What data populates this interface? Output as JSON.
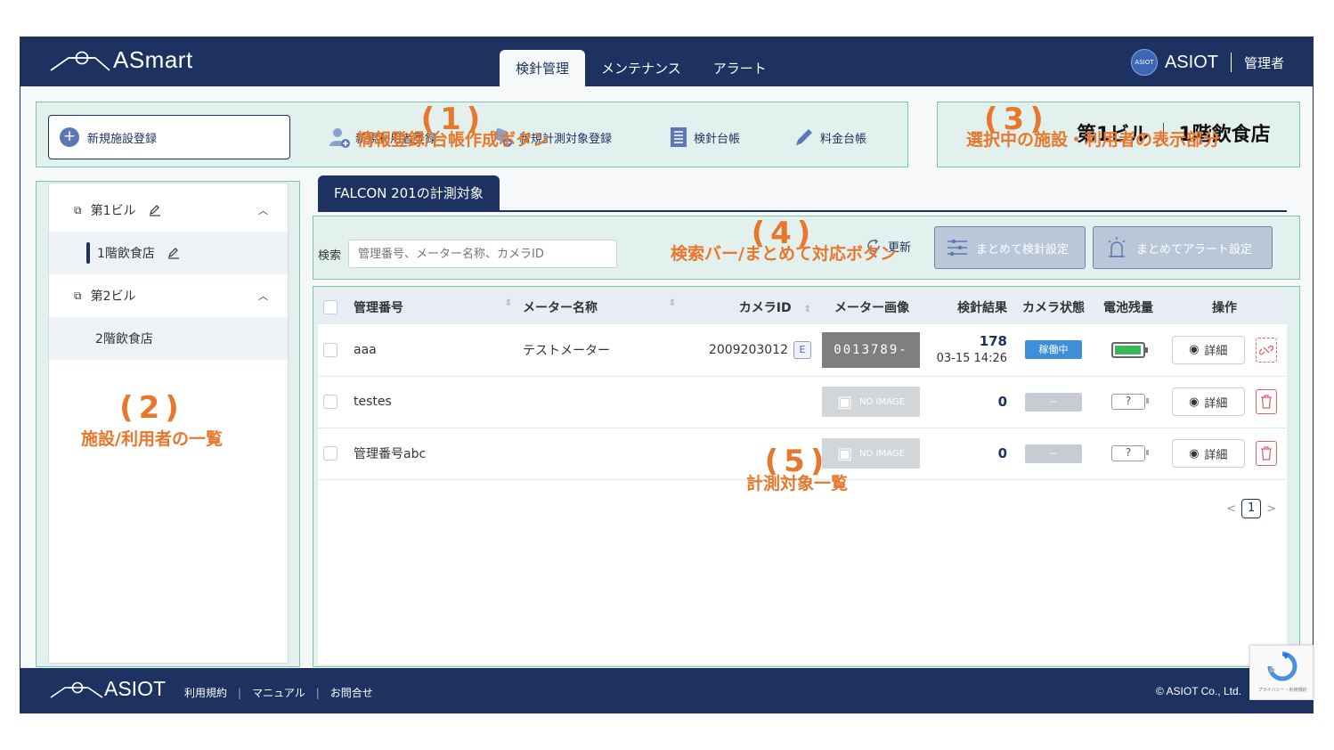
{
  "header": {
    "logo": "ASmart",
    "tabs": [
      "検針管理",
      "メンテナンス",
      "アラート"
    ],
    "user": {
      "avatar_text": "ASIOT",
      "name": "ASIOT",
      "role": "管理者"
    }
  },
  "actions": {
    "new_facility": "新規施設登録",
    "new_user": "新規利用者登録",
    "new_target": "新規計測対象登録",
    "reading_ledger": "検針台帳",
    "fee_ledger": "料金台帳"
  },
  "selected": {
    "facility": "第1ビル",
    "user": "1階飲食店"
  },
  "sidebar": {
    "items": [
      {
        "label": "第1ビル",
        "type": "facility",
        "editable": true,
        "expanded": true
      },
      {
        "label": "1階飲食店",
        "type": "user",
        "editable": true,
        "selected": true
      },
      {
        "label": "第2ビル",
        "type": "facility",
        "editable": false,
        "expanded": true
      },
      {
        "label": "2階飲食店",
        "type": "user",
        "editable": false
      }
    ]
  },
  "main": {
    "tab": "FALCON 201の計測対象",
    "search_label": "検索",
    "search_placeholder": "管理番号、メーター名称、カメラID",
    "refresh": "更新",
    "bulk_reading": "まとめて検針設定",
    "bulk_alert": "まとめてアラート設定"
  },
  "table": {
    "columns": [
      "管理番号",
      "メーター名称",
      "カメラID",
      "メーター画像",
      "検針結果",
      "カメラ状態",
      "電池残量",
      "操作"
    ],
    "rows": [
      {
        "id": "aaa",
        "meter": "テストメーター",
        "camera": "2009203012",
        "camera_badge": "E",
        "image": "0013789-",
        "value": "178",
        "time": "03-15 14:26",
        "status": "稼働中",
        "battery": 0.9,
        "detail": "詳細"
      },
      {
        "id": "testes",
        "meter": "",
        "camera": "",
        "camera_badge": "",
        "image": "NO IMAGE",
        "value": "0",
        "time": "",
        "status": "－",
        "battery": "?",
        "detail": "詳細"
      },
      {
        "id": "管理番号abc",
        "meter": "",
        "camera": "",
        "camera_badge": "",
        "image": "NO IMAGE",
        "value": "0",
        "time": "",
        "status": "－",
        "battery": "?",
        "detail": "詳細"
      }
    ],
    "page": "1"
  },
  "annotations": [
    {
      "num": "(1)",
      "text": "情報登録/台帳作成ボタン"
    },
    {
      "num": "(2)",
      "text": "施設/利用者の一覧"
    },
    {
      "num": "(3)",
      "text": "選択中の施設・利用者の表示部分"
    },
    {
      "num": "(4)",
      "text": "検索バー/まとめて対応ボタン"
    },
    {
      "num": "(5)",
      "text": "計測対象一覧"
    }
  ],
  "footer": {
    "logo": "ASIOT",
    "links": [
      "利用規約",
      "マニュアル",
      "お問合せ"
    ],
    "copyright": "© ASIOT Co., Ltd."
  },
  "recaptcha": {
    "text": "プライバシー・利用規約"
  },
  "colors": {
    "navy": "#1d3260",
    "annotation": "#e8772e",
    "highlight": "#7cc4b0"
  }
}
